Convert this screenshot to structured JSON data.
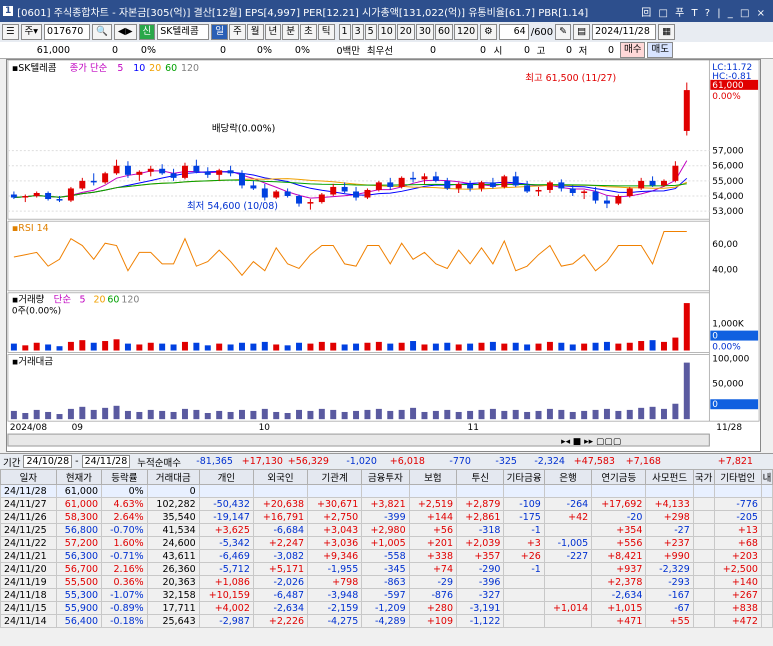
{
  "title": {
    "num": "1",
    "text": "[0601] 주식종합차트 - 자본금[305(억)] 결산[12월] EPS[4,997] PER[12.21] 시가총액[131,022(억)] 유통비율[61.7] PBR[1.14]",
    "controls": "回 □ 푸 T ? | _ □ ×"
  },
  "toolbar": {
    "code": "017670",
    "stock_name": "SK텔레콤",
    "periods": [
      "일",
      "주",
      "월",
      "년",
      "분",
      "초",
      "틱"
    ],
    "selected_period": "일",
    "intervals": [
      "1",
      "3",
      "5",
      "10",
      "20",
      "30",
      "60",
      "120"
    ],
    "count": "64",
    "total": "/600",
    "date": "2024/11/28"
  },
  "quote": {
    "price": "61,000",
    "v1": "0",
    "pct1": "0%",
    "v2": "0",
    "pct2": "0%",
    "pct3": "0%",
    "vol_label": "0백만",
    "best_label": "최우선",
    "b1": "0",
    "b2": "0",
    "si": "시",
    "si_v": "0",
    "go": "고",
    "go_v": "0",
    "jeo": "저",
    "jeo_v": "0",
    "buy": "매수",
    "sell": "매도"
  },
  "chart": {
    "panels": [
      "SK텔레콤",
      "RSI 14",
      "거래량",
      "거래대금"
    ],
    "ma_title": "종가 단순",
    "ma": [
      "5",
      "10",
      "20",
      "60",
      "120"
    ],
    "vol_ma_title": "단순",
    "vol_ma": [
      "5",
      "20",
      "60",
      "120"
    ],
    "vol_sub": "0주(0.00%)",
    "high_label": "최고 61,500 (11/27)",
    "low_label": "최저 54,600 (10/08)",
    "div_label": "배당락(0.00%)",
    "lc": "LC:11.72",
    "hc": "HC:-0.81",
    "cur_price": "61,000",
    "cur_pct": "0.00%",
    "x_labels": [
      "2024/08",
      "09",
      "10",
      "11",
      "11/28"
    ],
    "y_price": [
      "57,000",
      "56,000",
      "55,000",
      "54,000",
      "53,000"
    ],
    "y_rsi": [
      "60,00",
      "40,00"
    ],
    "y_vol": [
      "1,000K",
      "0",
      "0.00%"
    ],
    "y_amt": [
      "100,000",
      "50,000",
      "0"
    ]
  },
  "chart_data": {
    "type": "bar",
    "title": "SK텔레콤 일봉",
    "candles": [
      [
        54.1,
        54.3,
        53.8,
        53.9
      ],
      [
        53.9,
        54.1,
        53.6,
        54.0
      ],
      [
        54.0,
        54.3,
        53.9,
        54.2
      ],
      [
        54.2,
        54.3,
        53.7,
        53.8
      ],
      [
        53.8,
        54.0,
        53.6,
        53.7
      ],
      [
        53.7,
        54.6,
        53.6,
        54.5
      ],
      [
        54.5,
        55.2,
        54.4,
        55.0
      ],
      [
        55.0,
        55.5,
        54.7,
        54.9
      ],
      [
        54.9,
        55.6,
        54.8,
        55.5
      ],
      [
        55.5,
        56.4,
        55.4,
        56.0
      ],
      [
        56.0,
        56.3,
        55.2,
        55.4
      ],
      [
        55.4,
        55.7,
        55.0,
        55.6
      ],
      [
        55.6,
        56.0,
        55.3,
        55.8
      ],
      [
        55.8,
        56.1,
        55.4,
        55.5
      ],
      [
        55.5,
        55.8,
        55.0,
        55.2
      ],
      [
        55.2,
        56.2,
        55.1,
        56.0
      ],
      [
        56.0,
        56.4,
        55.5,
        55.6
      ],
      [
        55.6,
        55.9,
        55.2,
        55.4
      ],
      [
        55.4,
        55.8,
        55.0,
        55.7
      ],
      [
        55.7,
        56.0,
        55.3,
        55.5
      ],
      [
        55.5,
        55.7,
        54.5,
        54.7
      ],
      [
        54.7,
        55.0,
        54.4,
        54.5
      ],
      [
        54.5,
        54.8,
        53.7,
        53.9
      ],
      [
        53.9,
        54.4,
        53.8,
        54.3
      ],
      [
        54.3,
        54.5,
        53.9,
        54.0
      ],
      [
        54.0,
        54.1,
        53.3,
        53.5
      ],
      [
        53.5,
        53.8,
        53.1,
        53.6
      ],
      [
        53.6,
        54.2,
        53.5,
        54.1
      ],
      [
        54.1,
        54.8,
        54.0,
        54.6
      ],
      [
        54.6,
        54.9,
        54.2,
        54.3
      ],
      [
        54.3,
        54.6,
        53.7,
        53.9
      ],
      [
        53.9,
        54.5,
        53.8,
        54.4
      ],
      [
        54.4,
        55.0,
        54.3,
        54.9
      ],
      [
        54.9,
        55.2,
        54.4,
        54.6
      ],
      [
        54.6,
        55.3,
        54.5,
        55.2
      ],
      [
        55.2,
        55.6,
        54.9,
        55.1
      ],
      [
        55.1,
        55.5,
        54.8,
        55.3
      ],
      [
        55.3,
        55.6,
        54.9,
        55.0
      ],
      [
        55.0,
        55.2,
        54.4,
        54.5
      ],
      [
        54.5,
        54.9,
        54.2,
        54.8
      ],
      [
        54.8,
        55.0,
        54.3,
        54.5
      ],
      [
        54.5,
        55.0,
        54.3,
        54.9
      ],
      [
        54.9,
        55.2,
        54.5,
        54.6
      ],
      [
        54.6,
        55.4,
        54.5,
        55.3
      ],
      [
        55.3,
        55.6,
        54.6,
        54.7
      ],
      [
        54.7,
        55.0,
        54.2,
        54.3
      ],
      [
        54.3,
        54.6,
        54.0,
        54.4
      ],
      [
        54.4,
        55.0,
        54.2,
        54.9
      ],
      [
        54.9,
        55.1,
        54.3,
        54.5
      ],
      [
        54.5,
        54.7,
        54.0,
        54.2
      ],
      [
        54.2,
        54.4,
        53.8,
        54.3
      ],
      [
        54.3,
        54.6,
        53.5,
        53.7
      ],
      [
        53.7,
        54.0,
        53.2,
        53.5
      ],
      [
        53.5,
        54.1,
        53.4,
        54.0
      ],
      [
        54.0,
        54.6,
        53.9,
        54.5
      ],
      [
        54.5,
        55.2,
        54.4,
        55.0
      ],
      [
        55.0,
        55.3,
        54.6,
        54.7
      ],
      [
        54.7,
        55.1,
        54.6,
        55.0
      ],
      [
        55.0,
        56.3,
        54.9,
        56.0
      ],
      [
        58.3,
        61.5,
        58.0,
        61.0
      ]
    ],
    "volume": [
      8,
      6,
      9,
      7,
      5,
      10,
      12,
      9,
      11,
      13,
      8,
      7,
      9,
      8,
      7,
      10,
      9,
      6,
      8,
      7,
      9,
      8,
      10,
      7,
      6,
      9,
      8,
      10,
      9,
      7,
      8,
      9,
      10,
      8,
      9,
      11,
      7,
      8,
      9,
      7,
      8,
      9,
      10,
      8,
      9,
      7,
      8,
      10,
      9,
      7,
      8,
      9,
      10,
      8,
      9,
      11,
      12,
      10,
      15,
      55
    ],
    "xlabel": "",
    "ylabel": ""
  },
  "grid": {
    "period_label": "기간",
    "from": "24/10/28",
    "to": "24/11/28",
    "net_label": "누적순매수",
    "sums": [
      "-81,365",
      "+17,130",
      "+56,329",
      "-1,020",
      "+6,018",
      "-770",
      "-325",
      "-2,324",
      "+47,583",
      "+7,168",
      "",
      "+7,821"
    ],
    "headers": [
      "일자",
      "현재가",
      "등락률",
      "거래대금",
      "개인",
      "외국인",
      "기관계",
      "금융투자",
      "보험",
      "투신",
      "기타금융",
      "은행",
      "연기금등",
      "사모펀드",
      "국가",
      "기타법인",
      "내"
    ],
    "rows": [
      [
        "24/11/28",
        "61,000",
        "0%",
        "0",
        "",
        "",
        "",
        "",
        "",
        "",
        "",
        "",
        "",
        "",
        "",
        ""
      ],
      [
        "24/11/27",
        "61,000",
        "4.63%",
        "102,282",
        "-50,432",
        "+20,638",
        "+30,671",
        "+3,821",
        "+2,519",
        "+2,879",
        "-109",
        "-264",
        "+17,692",
        "+4,133",
        "",
        "-776"
      ],
      [
        "24/11/26",
        "58,300",
        "2.64%",
        "35,540",
        "-19,147",
        "+16,791",
        "+2,750",
        "-399",
        "+144",
        "+2,861",
        "-175",
        "+42",
        "-20",
        "+298",
        "",
        "-205"
      ],
      [
        "24/11/25",
        "56,800",
        "-0.70%",
        "41,534",
        "+3,625",
        "-6,684",
        "+3,043",
        "+2,980",
        "+56",
        "-318",
        "-1",
        "",
        "+354",
        "-27",
        "",
        "+13"
      ],
      [
        "24/11/22",
        "57,200",
        "1.60%",
        "24,600",
        "-5,342",
        "+2,247",
        "+3,036",
        "+1,005",
        "+201",
        "+2,039",
        "+3",
        "-1,005",
        "+556",
        "+237",
        "",
        "+68"
      ],
      [
        "24/11/21",
        "56,300",
        "-0.71%",
        "43,611",
        "-6,469",
        "-3,082",
        "+9,346",
        "-558",
        "+338",
        "+357",
        "+26",
        "-227",
        "+8,421",
        "+990",
        "",
        "+203"
      ],
      [
        "24/11/20",
        "56,700",
        "2.16%",
        "26,360",
        "-5,712",
        "+5,171",
        "-1,955",
        "-345",
        "+74",
        "-290",
        "-1",
        "",
        "+937",
        "-2,329",
        "",
        "+2,500"
      ],
      [
        "24/11/19",
        "55,500",
        "0.36%",
        "20,363",
        "+1,086",
        "-2,026",
        "+798",
        "-863",
        "-29",
        "-396",
        "",
        "",
        "+2,378",
        "-293",
        "",
        "+140"
      ],
      [
        "24/11/18",
        "55,300",
        "-1.07%",
        "32,158",
        "+10,159",
        "-6,487",
        "-3,948",
        "-597",
        "-876",
        "-327",
        "",
        "",
        "-2,634",
        "-167",
        "",
        "+267"
      ],
      [
        "24/11/15",
        "55,900",
        "-0.89%",
        "17,711",
        "+4,002",
        "-2,634",
        "-2,159",
        "-1,209",
        "+280",
        "-3,191",
        "",
        "+1,014",
        "+1,015",
        "-67",
        "",
        "+838"
      ],
      [
        "24/11/14",
        "56,400",
        "-0.18%",
        "25,643",
        "-2,987",
        "+2,226",
        "-4,275",
        "-4,289",
        "+109",
        "-1,122",
        "",
        "",
        "+471",
        "+55",
        "",
        "+472"
      ]
    ]
  }
}
